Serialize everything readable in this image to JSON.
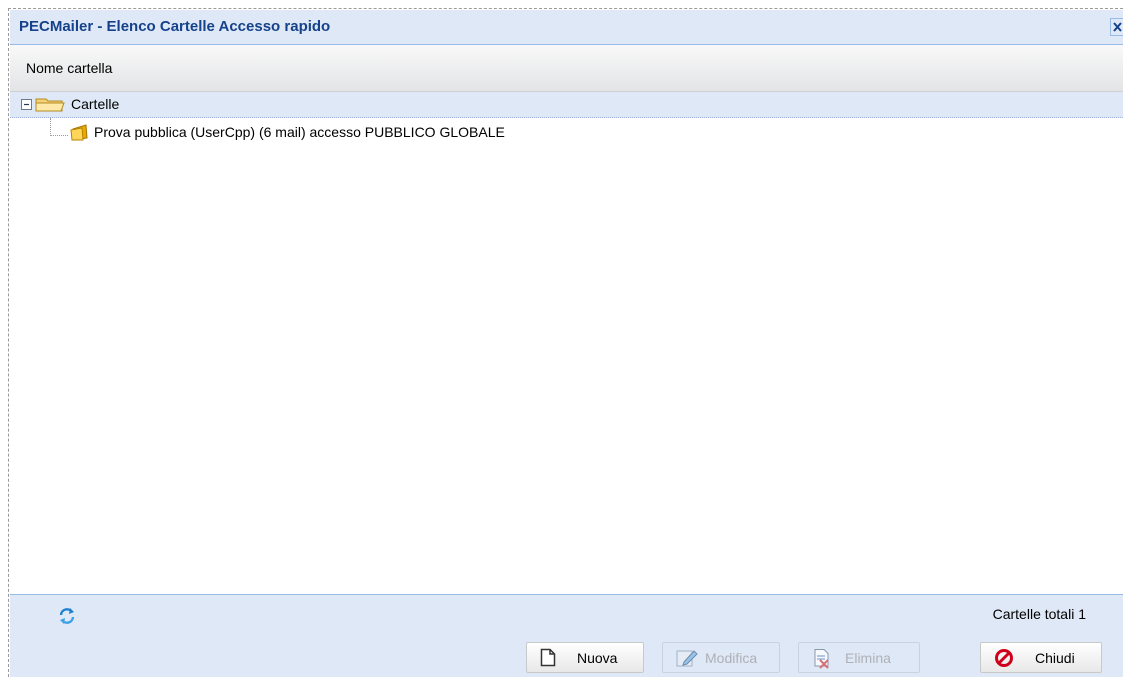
{
  "window": {
    "title": "PECMailer - Elenco Cartelle Accesso rapido"
  },
  "grid": {
    "column_header": "Nome cartella"
  },
  "tree": {
    "root": {
      "label": "Cartelle",
      "expanded": true
    },
    "children": [
      {
        "label": "Prova pubblica (UserCpp) (6 mail) accesso PUBBLICO GLOBALE"
      }
    ]
  },
  "status": {
    "count_text": "Cartelle totali 1"
  },
  "toolbar": {
    "new_label": "Nuova",
    "edit_label": "Modifica",
    "delete_label": "Elimina",
    "close_label": "Chiudi"
  },
  "icons": {
    "close": "close-icon",
    "collapse": "minus-box-icon",
    "root_folder": "open-folder-icon",
    "child_folder": "folder-icon",
    "refresh": "refresh-icon",
    "new": "new-document-icon",
    "edit": "edit-icon",
    "delete": "delete-document-icon",
    "close_button": "no-entry-icon"
  },
  "colors": {
    "title_text": "#15428b",
    "panel_bg": "#dfe8f6",
    "border": "#99bbe8",
    "close_icon_red": "#d0021b"
  }
}
